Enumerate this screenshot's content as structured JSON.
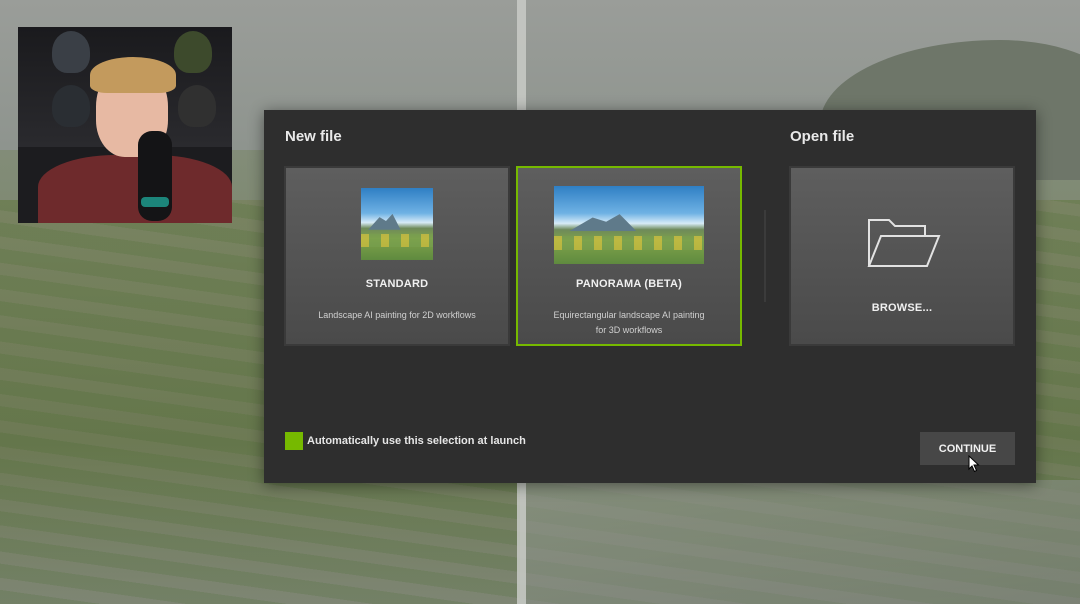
{
  "dialog": {
    "new_file_title": "New file",
    "open_file_title": "Open file",
    "cards": {
      "standard": {
        "title": "STANDARD",
        "desc": "Landscape AI painting for 2D workflows"
      },
      "panorama": {
        "title": "PANORAMA (BETA)",
        "desc_line1": "Equirectangular landscape AI painting",
        "desc_line2": "for 3D workflows"
      },
      "browse": {
        "title": "BROWSE...",
        "icon": "folder-icon"
      }
    },
    "auto_select_label": "Automatically use this selection at launch",
    "auto_select_checked": true,
    "continue_label": "CONTINUE"
  },
  "colors": {
    "accent": "#76b900",
    "dialog_bg": "#2e2e2e",
    "card_bg": "#545454"
  }
}
